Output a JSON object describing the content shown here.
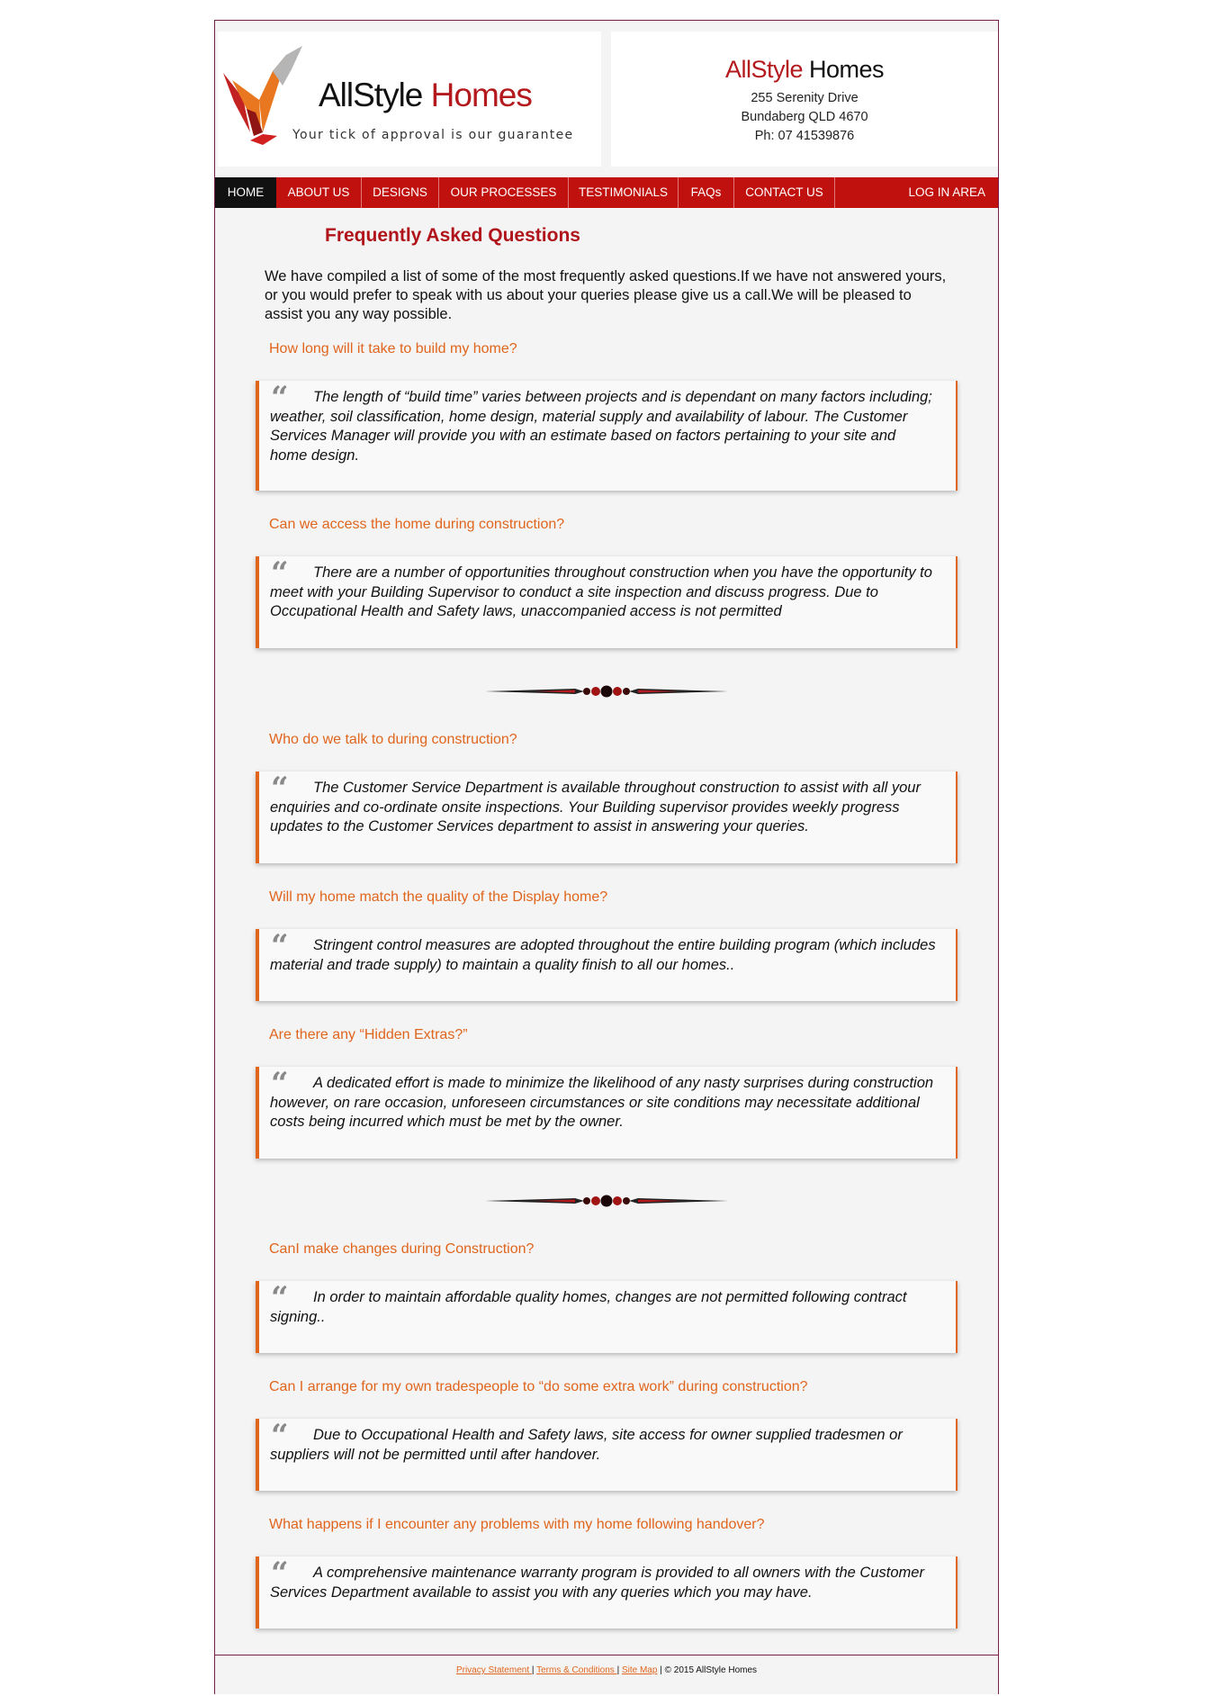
{
  "header": {
    "logo": {
      "name_first": "AllStyle",
      "name_second": "Homes",
      "tagline": "Your tick of approval is our guarantee"
    },
    "contact": {
      "name_first": "AllStyle",
      "name_second": "Homes",
      "address_line1": "255 Serenity Drive",
      "address_line2": "Bundaberg QLD 4670",
      "phone": "Ph: 07 41539876"
    }
  },
  "nav": {
    "items": [
      {
        "label": "HOME"
      },
      {
        "label": "ABOUT US"
      },
      {
        "label": "DESIGNS"
      },
      {
        "label": "OUR PROCESSES"
      },
      {
        "label": "TESTIMONIALS"
      },
      {
        "label": "FAQs"
      },
      {
        "label": "CONTACT US"
      }
    ],
    "login": "LOG IN AREA"
  },
  "main": {
    "title": "Frequently Asked Questions",
    "intro": "We have compiled a list of some of the most frequently asked questions.If we have not answered yours, or you would prefer to speak with us about your queries please give us a call.We will be pleased to assist you any way possible.",
    "faqs": [
      {
        "question": "How long will it take to build my home?",
        "answer": "The length of “build time” varies between projects and is dependant on many factors including; weather, soil classification, home design, material supply and availability of labour. The Customer Services Manager will provide you with an estimate based on factors pertaining to your site and home design."
      },
      {
        "question": "Can we access the home during construction?",
        "answer": "There are a number of opportunities throughout construction when you have the opportunity to meet with your Building Supervisor to conduct a site inspection and discuss progress. Due to Occupational Health and Safety laws, unaccompanied access is not permitted"
      },
      {
        "question": "Who do we talk to during construction?",
        "answer": "The Customer Service Department is available throughout construction to assist with all your enquiries and co-ordinate onsite inspections. Your Building supervisor provides weekly progress updates to the Customer Services department to assist in answering your queries."
      },
      {
        "question": "Will my home match the quality of the Display home?",
        "answer": "Stringent control measures are adopted throughout the entire building program (which includes material and trade supply) to maintain a quality finish to all our homes.."
      },
      {
        "question": "Are there any “Hidden Extras?”",
        "answer": "A dedicated effort is made to minimize the likelihood of any nasty surprises during construction however, on rare occasion, unforeseen circumstances or site conditions may necessitate additional costs being incurred which must be met by the owner."
      },
      {
        "question": "CanI make changes during Construction?",
        "answer": "In order to maintain affordable quality homes, changes are not permitted following contract signing.."
      },
      {
        "question": "Can I arrange for my own tradespeople to “do some extra work” during construction?",
        "answer": "Due to Occupational Health and Safety laws, site access for owner supplied tradesmen or suppliers will not be permitted until after handover."
      },
      {
        "question": "What happens if I encounter any problems with my home following handover?",
        "answer": "A comprehensive maintenance warranty program is provided to all owners with the Customer Services Department available to assist you with any queries which you may have."
      }
    ],
    "quote_mark": "“"
  },
  "footer": {
    "privacy": "Privacy Statement ",
    "terms": "Terms & Conditions ",
    "sitemap": "Site Map",
    "separator": "|",
    "copyright": "© 2015 AllStyle Homes"
  },
  "colors": {
    "brand_red": "#c1110f",
    "accent_orange": "#e0651d",
    "title_red": "#b0141a"
  }
}
